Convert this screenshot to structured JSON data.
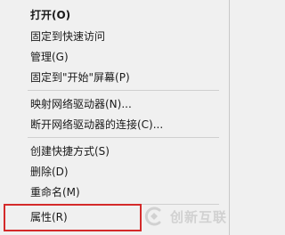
{
  "context_menu": {
    "items": [
      {
        "label": "打开(O)"
      },
      {
        "label": "固定到快速访问"
      },
      {
        "label": "管理(G)"
      },
      {
        "label": "固定到\"开始\"屏幕(P)"
      },
      {
        "label": "映射网络驱动器(N)..."
      },
      {
        "label": "断开网络驱动器的连接(C)..."
      },
      {
        "label": "创建快捷方式(S)"
      },
      {
        "label": "删除(D)"
      },
      {
        "label": "重命名(M)"
      },
      {
        "label": "属性(R)"
      }
    ]
  },
  "watermark": {
    "text": "创新互联",
    "color": "#b9b9b9"
  },
  "colors": {
    "menu_background": "#f0f0f0",
    "highlight_border": "#d42a2a",
    "separator": "#cfcfcf"
  }
}
